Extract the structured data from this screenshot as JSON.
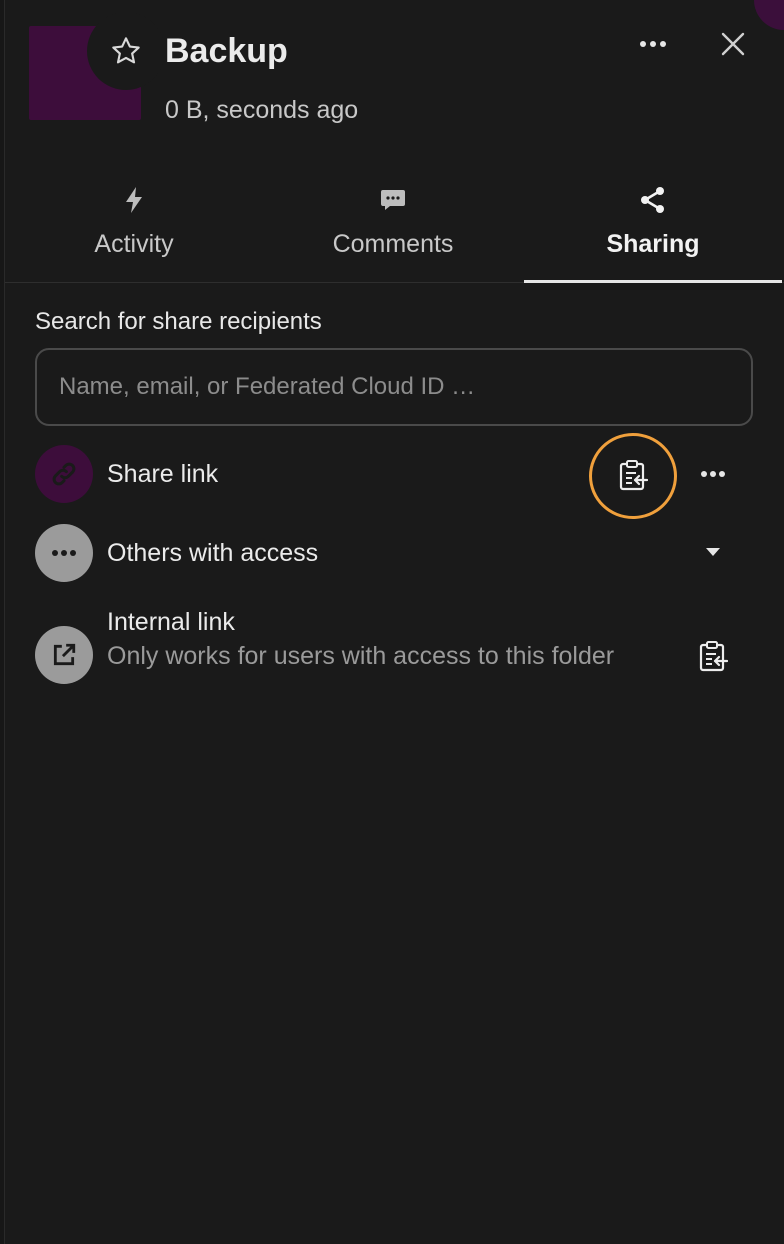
{
  "header": {
    "title": "Backup",
    "subtitle": "0 B, seconds ago",
    "icons": {
      "favorite": "star-outline-icon",
      "more": "dots-horizontal-icon",
      "close": "close-icon"
    }
  },
  "tabs": [
    {
      "label": "Activity",
      "icon": "lightning-icon",
      "active": false
    },
    {
      "label": "Comments",
      "icon": "comment-icon",
      "active": false
    },
    {
      "label": "Sharing",
      "icon": "share-icon",
      "active": true
    }
  ],
  "search": {
    "label": "Search for share recipients",
    "placeholder": "Name, email, or Federated Cloud ID …",
    "value": ""
  },
  "share_link": {
    "title": "Share link",
    "icons": {
      "avatar": "link-icon",
      "copy": "clipboard-copy-icon",
      "more": "dots-horizontal-icon"
    }
  },
  "others_with_access": {
    "title": "Others with access",
    "icons": {
      "avatar": "dots-horizontal-icon",
      "toggle": "caret-down-icon"
    }
  },
  "internal_link": {
    "title": "Internal link",
    "subtitle": "Only works for users with access to this folder",
    "icons": {
      "avatar": "external-link-icon",
      "copy": "clipboard-copy-icon"
    }
  },
  "colors": {
    "background": "#1a1a1a",
    "accent_purple": "#3d0d3b",
    "highlight_orange": "#f0a03c",
    "avatar_gray": "#9b9b9b"
  }
}
